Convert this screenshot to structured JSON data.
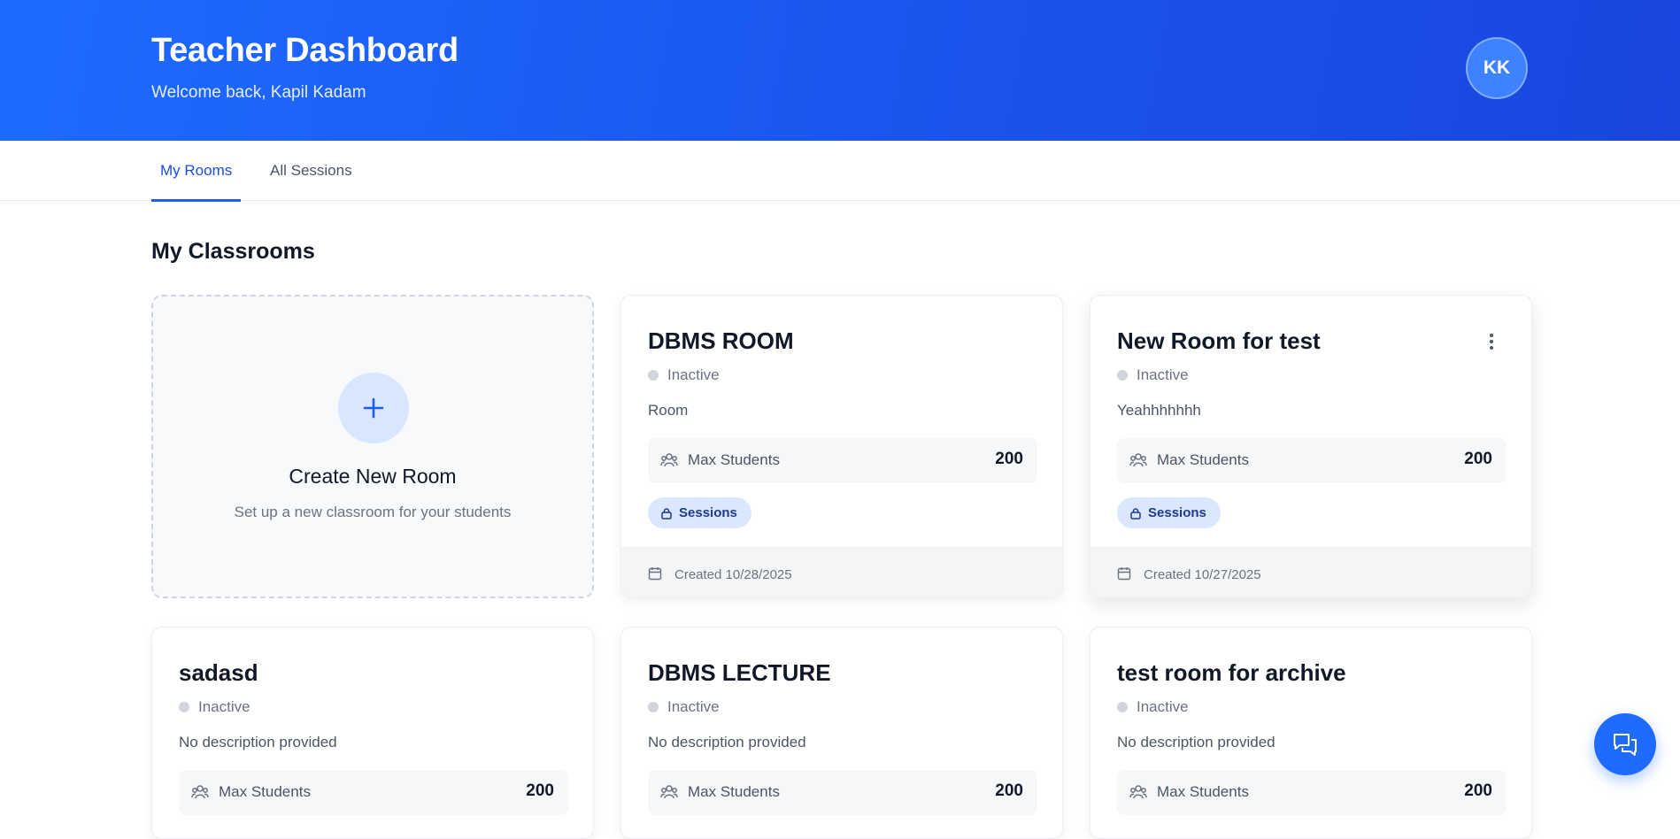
{
  "header": {
    "title": "Teacher Dashboard",
    "subtitle": "Welcome back, Kapil Kadam",
    "avatar_initials": "KK"
  },
  "tabs": [
    {
      "label": "My Rooms",
      "active": true
    },
    {
      "label": "All Sessions",
      "active": false
    }
  ],
  "main": {
    "section_title": "My Classrooms",
    "create_card": {
      "title": "Create New Room",
      "description": "Set up a new classroom for your students",
      "icon": "plus-icon"
    },
    "rooms": [
      {
        "name": "DBMS ROOM",
        "status": "Inactive",
        "description": "Room",
        "stat_label": "Max Students",
        "stat_value": "200",
        "tag": "Sessions",
        "created": "Created 10/28/2025",
        "has_menu": false
      },
      {
        "name": "New Room for test",
        "status": "Inactive",
        "description": "Yeahhhhhhh",
        "stat_label": "Max Students",
        "stat_value": "200",
        "tag": "Sessions",
        "created": "Created 10/27/2025",
        "has_menu": true
      },
      {
        "name": "sadasd",
        "status": "Inactive",
        "description": "No description provided",
        "stat_label": "Max Students",
        "stat_value": "200"
      },
      {
        "name": "DBMS LECTURE",
        "status": "Inactive",
        "description": "No description provided",
        "stat_label": "Max Students",
        "stat_value": "200"
      },
      {
        "name": "test room for archive",
        "status": "Inactive",
        "description": "No description provided",
        "stat_label": "Max Students",
        "stat_value": "200"
      }
    ]
  },
  "colors": {
    "primary": "#1f6bff",
    "header_gradient_end": "#1946dd",
    "status_inactive": "#d1d5db",
    "pill_bg": "#dbe7ff"
  },
  "icons": {
    "students": "users-icon",
    "sessions": "lock-icon",
    "created": "calendar-icon",
    "menu": "kebab-menu-icon",
    "chat": "chat-bubbles-icon"
  }
}
